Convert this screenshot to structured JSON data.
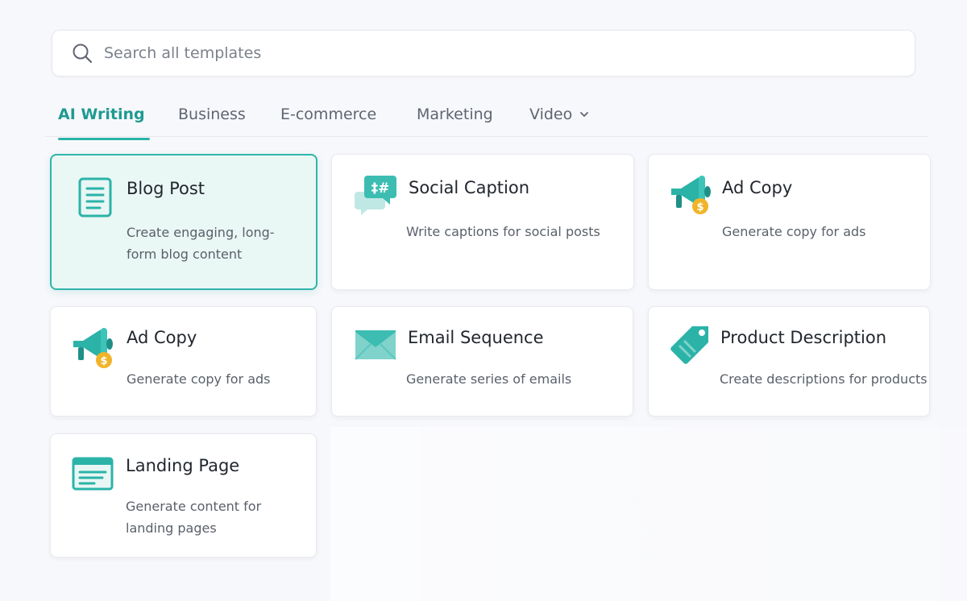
{
  "search": {
    "placeholder": "Search all templates"
  },
  "tabs": [
    {
      "label": "AI Writing",
      "active": true
    },
    {
      "label": "Business"
    },
    {
      "label": "E-commerce"
    },
    {
      "label": "Marketing"
    },
    {
      "label": "Video",
      "has_dropdown": true
    }
  ],
  "cards": [
    {
      "title": "Blog Post",
      "desc": "Create engaging, long-form blog content",
      "icon": "document-icon",
      "selected": true
    },
    {
      "title": "Social Caption",
      "desc": "Write captions for social posts",
      "icon": "hashtag-chat-icon"
    },
    {
      "title": "Ad Copy",
      "desc": "Generate copy for ads",
      "icon": "megaphone-icon"
    },
    {
      "title": "Ad Copy",
      "desc": "Generate copy for ads",
      "icon": "megaphone-icon"
    },
    {
      "title": "Email Sequence",
      "desc": "Generate series of emails",
      "icon": "envelope-icon"
    },
    {
      "title": "Product Description",
      "desc": "Create descriptions for products",
      "icon": "price-tag-icon"
    },
    {
      "title": "Landing Page",
      "desc": "Generate content for landing pages",
      "icon": "webpage-icon"
    }
  ],
  "colors": {
    "accent": "#2bb3a8",
    "accent_text": "#1f9a92",
    "selected_bg": "#e9f7f5",
    "coin": "#f0b429"
  }
}
